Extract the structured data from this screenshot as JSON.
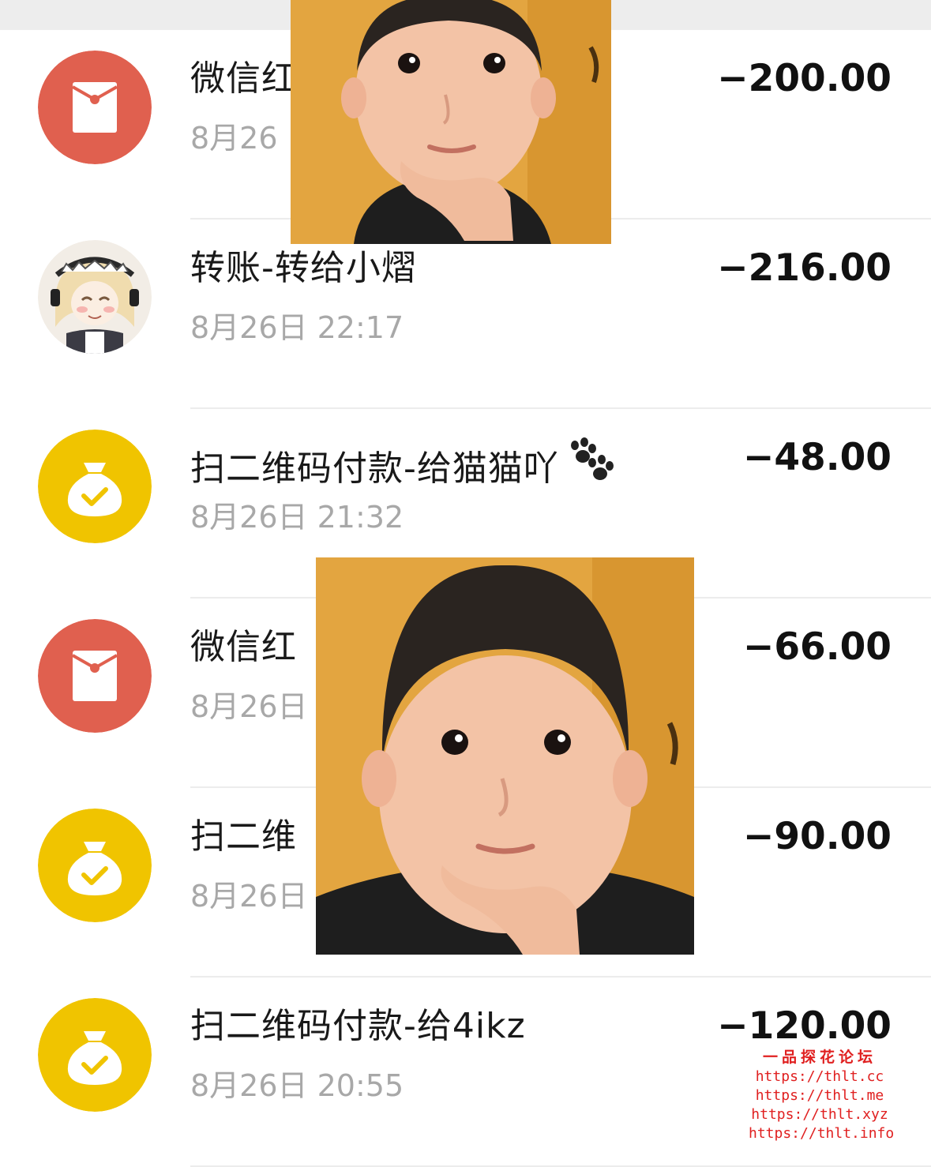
{
  "transactions": [
    {
      "icon": "red-packet-icon",
      "title": "微信红",
      "time": "8月26",
      "amount": "−200.00"
    },
    {
      "icon": "contact-avatar",
      "title": "转账-转给小熠",
      "time": "8月26日 22:17",
      "amount": "−216.00"
    },
    {
      "icon": "money-bag-icon",
      "title": "扫二维码付款-给猫猫吖",
      "title_emoji": "paw-prints-icon",
      "time": "8月26日 21:32",
      "amount": "−48.00"
    },
    {
      "icon": "red-packet-icon",
      "title": "微信红",
      "time": "8月26日",
      "amount": "−66.00"
    },
    {
      "icon": "money-bag-icon",
      "title": "扫二维",
      "time": "8月26日",
      "amount": "−90.00"
    },
    {
      "icon": "money-bag-icon",
      "title": "扫二维码付款-给4ikz",
      "time": "8月26日 20:55",
      "amount": "−120.00"
    }
  ],
  "watermark": {
    "title": "一品探花论坛",
    "urls": [
      "https://thlt.cc",
      "https://thlt.me",
      "https://thlt.xyz",
      "https://thlt.info"
    ]
  },
  "colors": {
    "red_packet": "#e0604f",
    "money_bag": "#f0c400",
    "text_primary": "#191919",
    "text_secondary": "#a8a8a8",
    "divider": "#ececec",
    "watermark": "#e02020"
  }
}
